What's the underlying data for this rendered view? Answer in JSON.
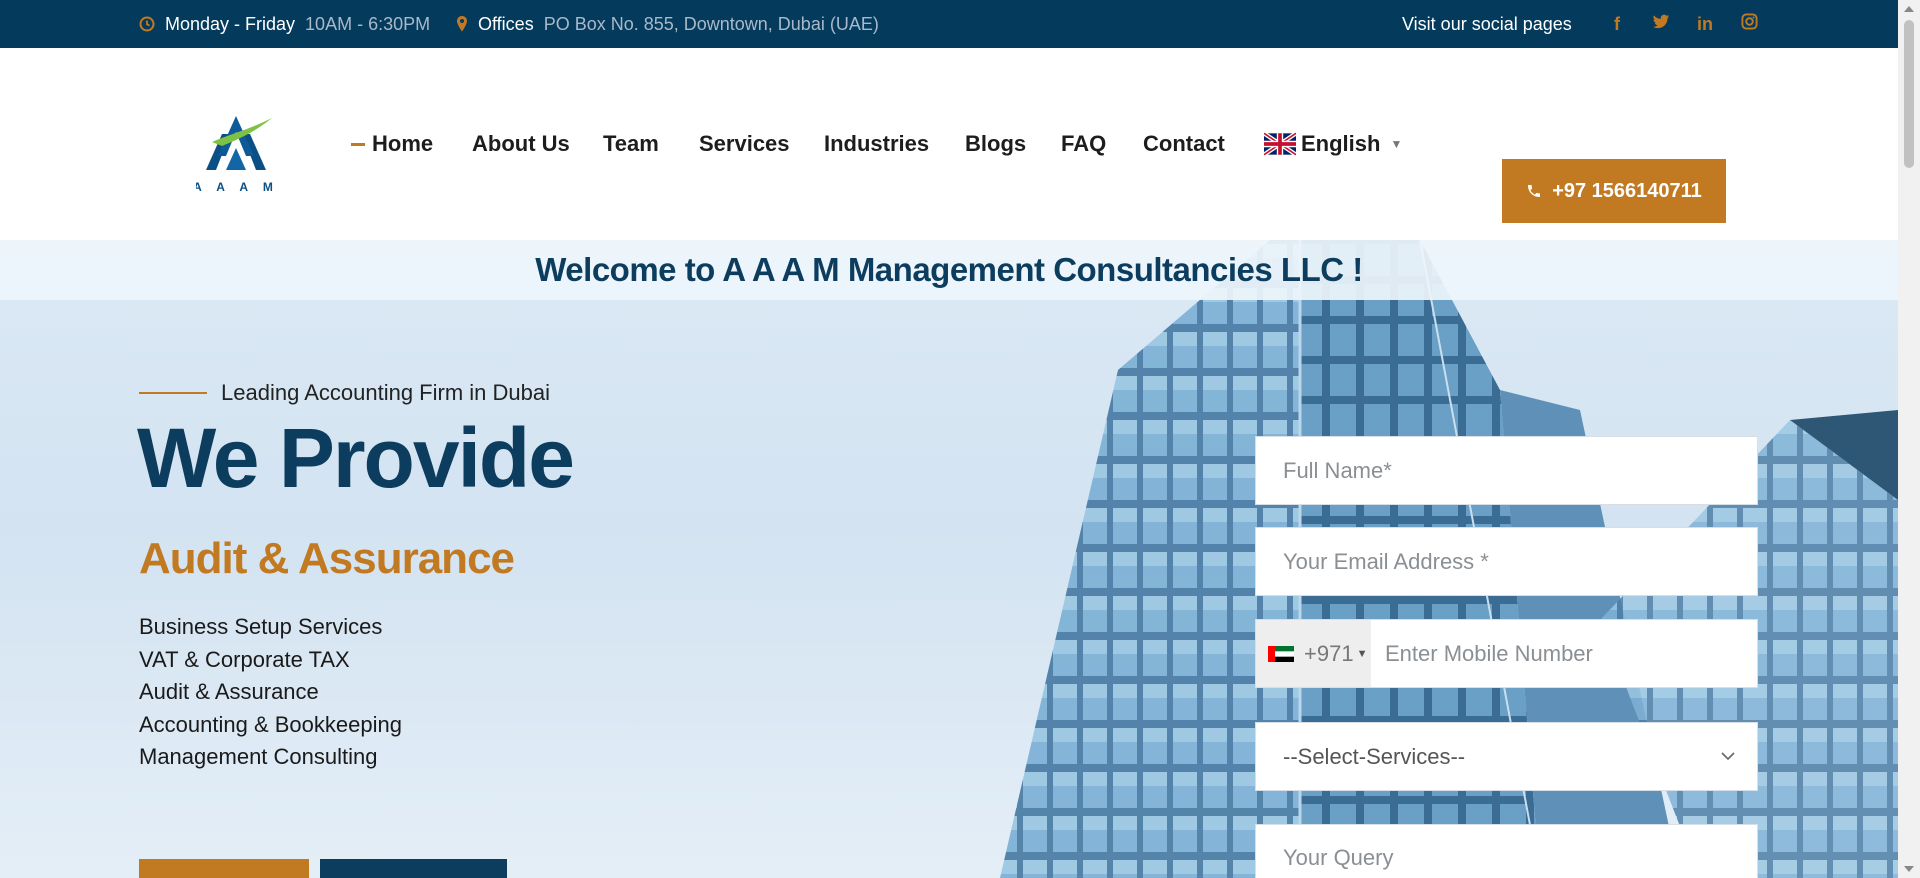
{
  "topbar": {
    "hours_label": "Monday - Friday",
    "hours_value": "10AM - 6:30PM",
    "offices_label": "Offices",
    "offices_value": "PO Box No. 855, Downtown, Dubai (UAE)",
    "social_label": "Visit our social pages",
    "social_icons": [
      "facebook-icon",
      "twitter-icon",
      "linkedin-icon",
      "instagram-icon"
    ]
  },
  "header": {
    "logo_text": "A A A M",
    "nav": [
      {
        "label": "Home",
        "active": true
      },
      {
        "label": "About Us"
      },
      {
        "label": "Team"
      },
      {
        "label": "Services"
      },
      {
        "label": "Industries"
      },
      {
        "label": "Blogs"
      },
      {
        "label": "FAQ"
      },
      {
        "label": "Contact"
      }
    ],
    "language": "English",
    "phone_button": "+97 1566140711"
  },
  "hero": {
    "welcome": "Welcome to A A A M Management Consultancies LLC !",
    "kicker": "Leading Accounting Firm in Dubai",
    "title": "We Provide",
    "subtitle": "Audit & Assurance",
    "services": [
      "Business Setup Services",
      "VAT & Corporate TAX",
      "Audit & Assurance",
      "Accounting & Bookkeeping",
      "Management Consulting"
    ]
  },
  "form": {
    "name_placeholder": "Full Name*",
    "email_placeholder": "Your Email Address *",
    "country_code": "+971",
    "mobile_placeholder": "Enter Mobile Number",
    "services_select": "--Select-Services--",
    "query_placeholder": "Your Query"
  },
  "colors": {
    "brand_navy": "#0d3d5e",
    "topbar_bg": "#043a5c",
    "accent_orange": "#c27a22"
  }
}
